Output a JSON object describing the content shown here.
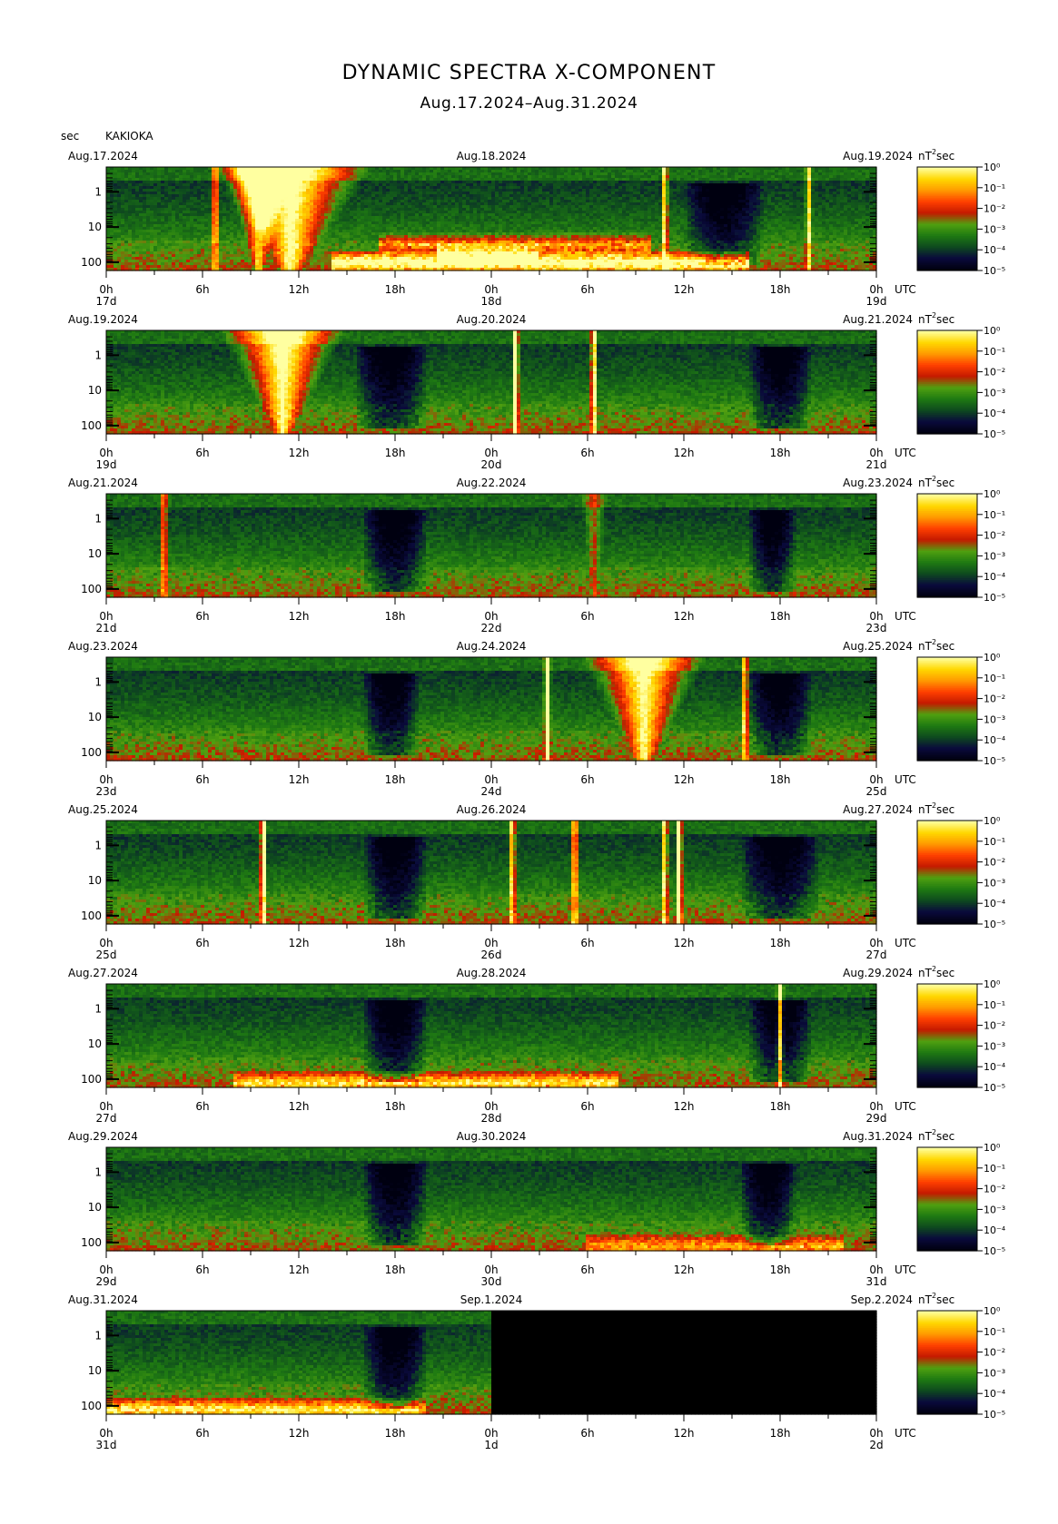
{
  "title": "DYNAMIC SPECTRA X-COMPONENT",
  "subtitle": "Aug.17.2024–Aug.31.2024",
  "header": {
    "sec": "sec",
    "station": "KAKIOKA"
  },
  "colors": {
    "scale": [
      "#000010",
      "#0a0a3c",
      "#0e4a1e",
      "#1f7a12",
      "#50a010",
      "#c41a00",
      "#ff4000",
      "#ff9a00",
      "#ffd800",
      "#ffffa0"
    ],
    "panel_frame": "#000000"
  },
  "chart_data": {
    "type": "heatmap",
    "title": "DYNAMIC SPECTRA X-COMPONENT",
    "units": "nT²sec",
    "y_axis": {
      "label": "sec",
      "scale": "log",
      "ticks": [
        "1",
        "10",
        "100"
      ],
      "range_sec": [
        0.3,
        150
      ]
    },
    "x_axis": {
      "ticks": [
        "0h",
        "6h",
        "12h",
        "18h",
        "0h",
        "6h",
        "12h",
        "18h",
        "0h"
      ],
      "utc_label": "UTC"
    },
    "colorbar": {
      "scale": "log",
      "ticks": [
        "10⁰",
        "10⁻¹",
        "10⁻²",
        "10⁻³",
        "10⁻⁴",
        "10⁻⁵"
      ]
    },
    "panels": [
      {
        "left": "Aug.17.2024",
        "mid": "Aug.18.2024",
        "right": "Aug.19.2024",
        "days": [
          "17d",
          "18d",
          "19d"
        ],
        "data_end_h": 48,
        "quiet": [
          [
            36,
            41
          ]
        ],
        "spikes": [
          [
            6.8,
            0.8
          ],
          [
            34.8,
            0.8
          ],
          [
            43.8,
            0.7
          ]
        ],
        "bursts": [
          [
            11.5,
            4.5,
            1.0
          ],
          [
            9.5,
            2.0,
            0.8
          ]
        ],
        "bands": [
          [
            17,
            34,
            0.75,
            0.5
          ],
          [
            20.5,
            27,
            0.85,
            0.45
          ],
          [
            14,
            40,
            0.92,
            0.85
          ]
        ]
      },
      {
        "left": "Aug.19.2024",
        "mid": "Aug.20.2024",
        "right": "Aug.21.2024",
        "days": [
          "19d",
          "20d",
          "21d"
        ],
        "data_end_h": 48,
        "quiet": [
          [
            15.5,
            20
          ],
          [
            40,
            44
          ]
        ],
        "spikes": [
          [
            25.5,
            1.0
          ],
          [
            30.4,
            0.9
          ]
        ],
        "bursts": [
          [
            11.0,
            3.5,
            1.0
          ]
        ],
        "bands": []
      },
      {
        "left": "Aug.21.2024",
        "mid": "Aug.22.2024",
        "right": "Aug.23.2024",
        "days": [
          "21d",
          "22d",
          "23d"
        ],
        "data_end_h": 48,
        "quiet": [
          [
            16,
            20
          ],
          [
            40,
            43
          ]
        ],
        "spikes": [
          [
            3.6,
            0.65
          ]
        ],
        "bursts": [
          [
            30.4,
            0.8,
            0.35
          ]
        ],
        "bands": []
      },
      {
        "left": "Aug.23.2024",
        "mid": "Aug.24.2024",
        "right": "Aug.25.2024",
        "days": [
          "23d",
          "24d",
          "25d"
        ],
        "data_end_h": 48,
        "quiet": [
          [
            16,
            19.5
          ],
          [
            40,
            44
          ]
        ],
        "spikes": [
          [
            27.5,
            1.0
          ],
          [
            39.8,
            0.8
          ]
        ],
        "bursts": [
          [
            33.5,
            3.5,
            0.95
          ]
        ],
        "bands": []
      },
      {
        "left": "Aug.25.2024",
        "mid": "Aug.26.2024",
        "right": "Aug.27.2024",
        "days": [
          "25d",
          "26d",
          "27d"
        ],
        "data_end_h": 48,
        "quiet": [
          [
            16,
            20
          ],
          [
            39.5,
            44.5
          ]
        ],
        "spikes": [
          [
            9.8,
            1.0
          ],
          [
            25.3,
            0.8
          ],
          [
            29.2,
            0.9
          ],
          [
            34.8,
            0.8
          ],
          [
            35.7,
            1.0
          ]
        ],
        "bursts": [],
        "bands": []
      },
      {
        "left": "Aug.27.2024",
        "mid": "Aug.28.2024",
        "right": "Aug.29.2024",
        "days": [
          "27d",
          "28d",
          "29d"
        ],
        "data_end_h": 48,
        "quiet": [
          [
            16,
            20
          ],
          [
            40,
            44
          ]
        ],
        "spikes": [
          [
            42.0,
            0.9
          ]
        ],
        "bursts": [],
        "bands": [
          [
            8,
            32,
            0.95,
            0.55
          ]
        ]
      },
      {
        "left": "Aug.29.2024",
        "mid": "Aug.30.2024",
        "right": "Aug.31.2024",
        "days": [
          "29d",
          "30d",
          "31d"
        ],
        "data_end_h": 48,
        "quiet": [
          [
            16,
            20
          ],
          [
            39.5,
            43
          ]
        ],
        "spikes": [],
        "bursts": [],
        "bands": [
          [
            30,
            46,
            0.95,
            0.4
          ]
        ]
      },
      {
        "left": "Aug.31.2024",
        "mid": "Sep.1.2024",
        "right": "Sep.2.2024",
        "days": [
          "31d",
          "1d",
          "2d"
        ],
        "data_end_h": 24,
        "quiet": [
          [
            16,
            20
          ]
        ],
        "spikes": [],
        "bursts": [],
        "bands": [
          [
            0,
            20,
            0.95,
            0.6
          ]
        ]
      }
    ]
  }
}
